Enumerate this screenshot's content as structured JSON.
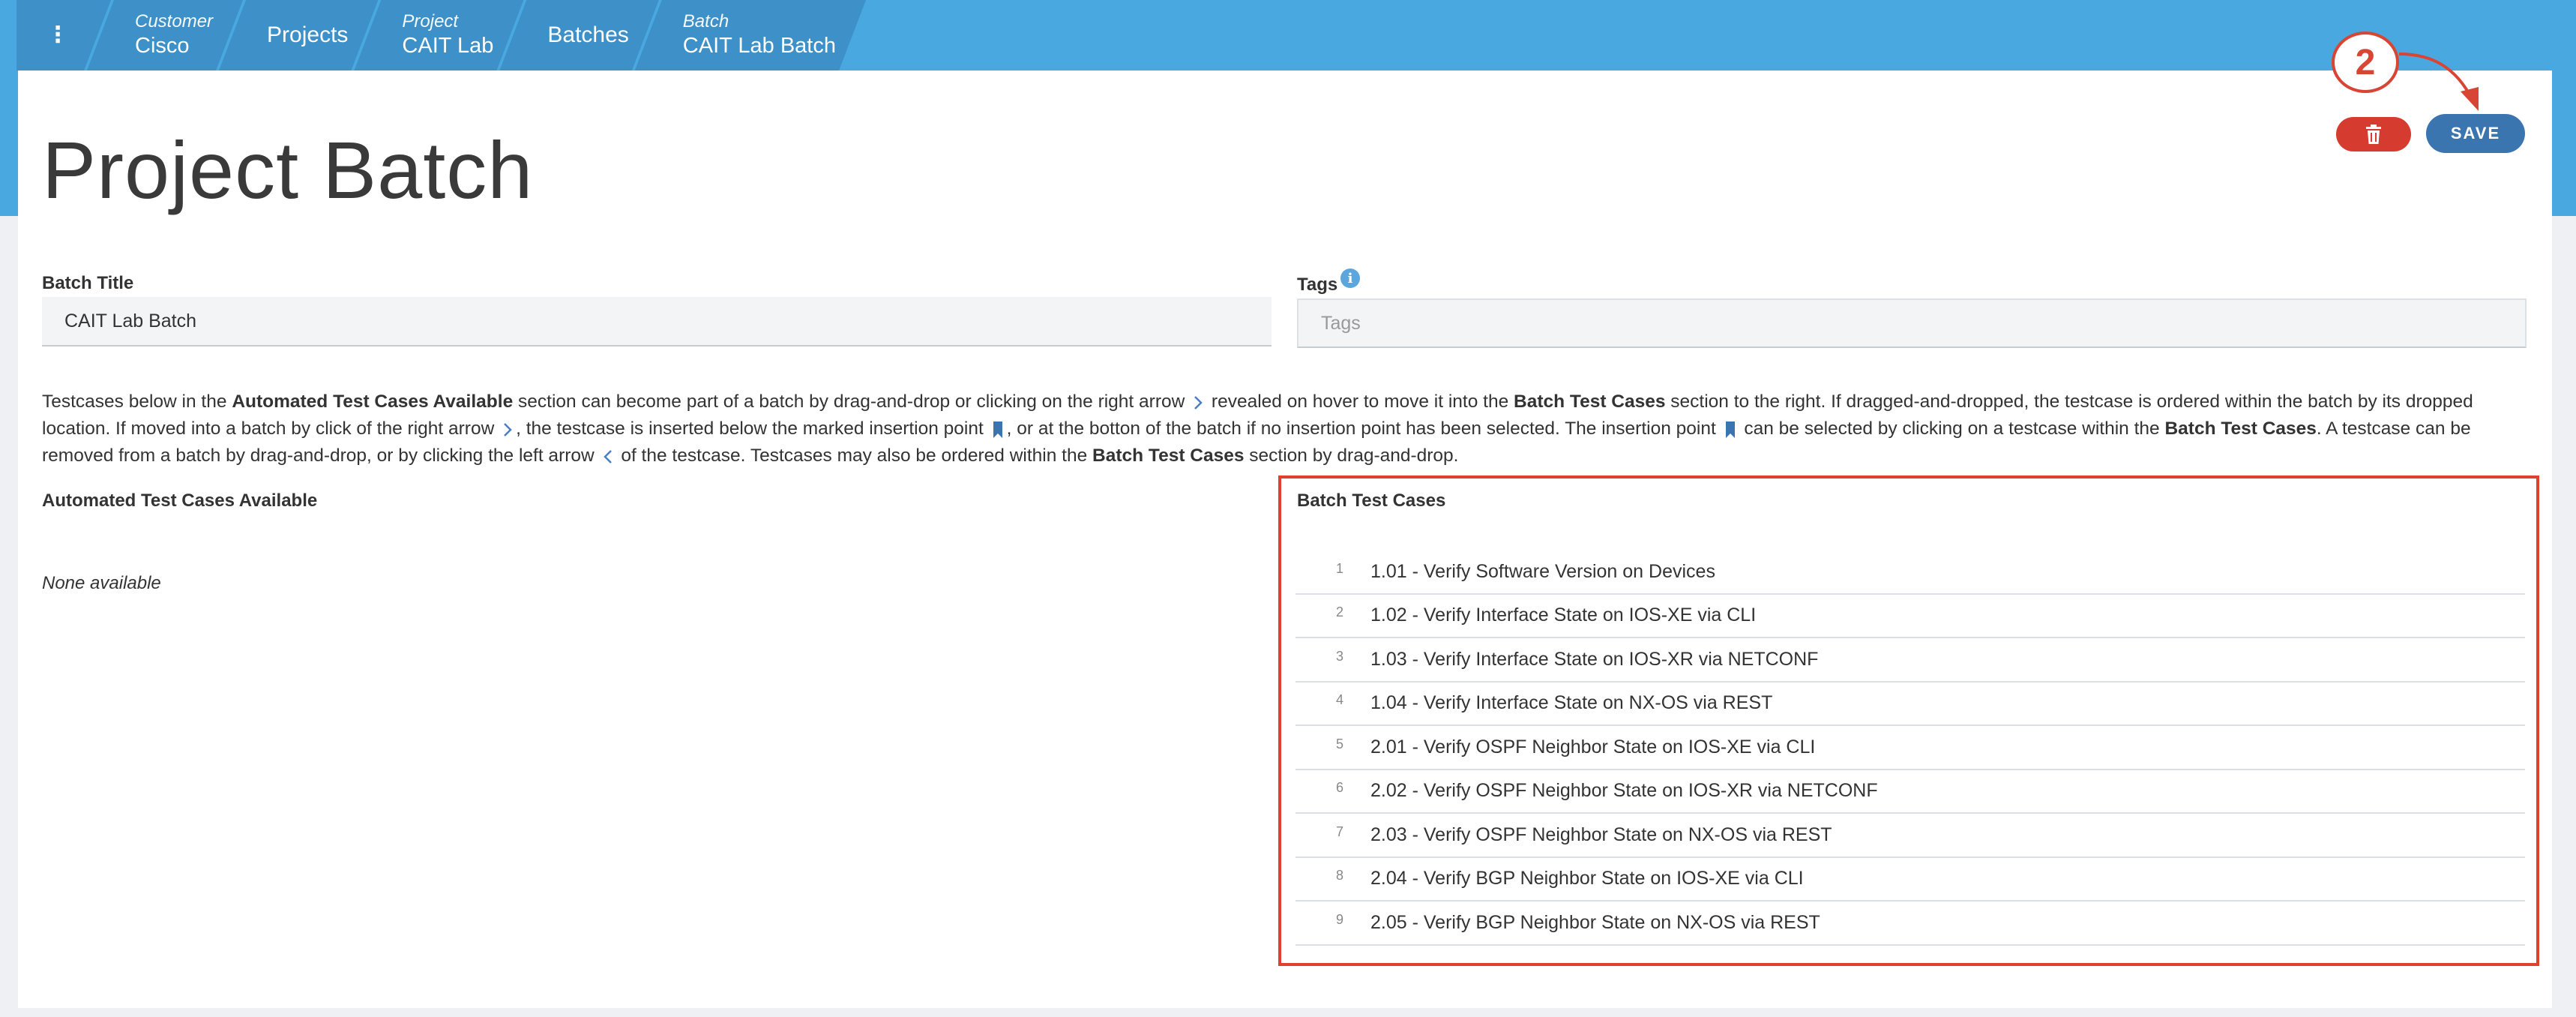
{
  "breadcrumb": {
    "menu_icon": "kebab-menu-icon",
    "items": [
      {
        "sub": "Customer",
        "main": "Cisco"
      },
      {
        "sub": "",
        "main": "Projects"
      },
      {
        "sub": "Project",
        "main": "CAIT Lab"
      },
      {
        "sub": "",
        "main": "Batches"
      },
      {
        "sub": "Batch",
        "main": "CAIT Lab Batch"
      }
    ]
  },
  "page": {
    "title": "Project Batch"
  },
  "toolbar": {
    "save_label": "SAVE",
    "delete_icon": "trash-icon"
  },
  "annotation": {
    "callout_number": "2"
  },
  "form": {
    "batch_title_label": "Batch Title",
    "batch_title_value": "CAIT Lab Batch",
    "tags_label": "Tags",
    "tags_placeholder": "Tags"
  },
  "help": {
    "p1": "Testcases below in the ",
    "b1": "Automated Test Cases Available",
    "p2": " section can become part of a batch by drag-and-drop or clicking on the right arrow ",
    "p3": " revealed on hover to move it into the ",
    "b2": "Batch Test Cases",
    "p4": " section to the right. If dragged-and-dropped, the testcase is ordered within the batch by its dropped location. If moved into a batch by click of the right arrow ",
    "p5": ", the testcase is inserted below the marked insertion point ",
    "p6": ", or at the botton of the batch if no insertion point has been selected. The insertion point ",
    "p7": " can be selected by clicking on a testcase within the ",
    "b3": "Batch Test Cases",
    "p8": ". A testcase can be removed from a batch by drag-and-drop, or by clicking the left arrow ",
    "p9": " of the testcase. Testcases may also be ordered within the ",
    "b4": "Batch Test Cases",
    "p10": " section by drag-and-drop."
  },
  "available": {
    "title": "Automated Test Cases Available",
    "empty_text": "None available"
  },
  "batch": {
    "title": "Batch Test Cases",
    "items": [
      {
        "num": "1",
        "label": "1.01 - Verify Software Version on Devices"
      },
      {
        "num": "2",
        "label": "1.02 - Verify Interface State on IOS-XE via CLI"
      },
      {
        "num": "3",
        "label": "1.03 - Verify Interface State on IOS-XR via NETCONF"
      },
      {
        "num": "4",
        "label": "1.04 - Verify Interface State on NX-OS via REST"
      },
      {
        "num": "5",
        "label": "2.01 - Verify OSPF Neighbor State on IOS-XE via CLI"
      },
      {
        "num": "6",
        "label": "2.02 - Verify OSPF Neighbor State on IOS-XR via NETCONF"
      },
      {
        "num": "7",
        "label": "2.03 - Verify OSPF Neighbor State on NX-OS via REST"
      },
      {
        "num": "8",
        "label": "2.04 - Verify BGP Neighbor State on IOS-XE via CLI"
      },
      {
        "num": "9",
        "label": "2.05 - Verify BGP Neighbor State on NX-OS via REST"
      }
    ]
  },
  "colors": {
    "header_band": "#49a8e0",
    "breadcrumb": "#3d90c8",
    "save_button": "#3b75b0",
    "delete_button": "#d63b2f",
    "annotation_red": "#e0402e"
  }
}
